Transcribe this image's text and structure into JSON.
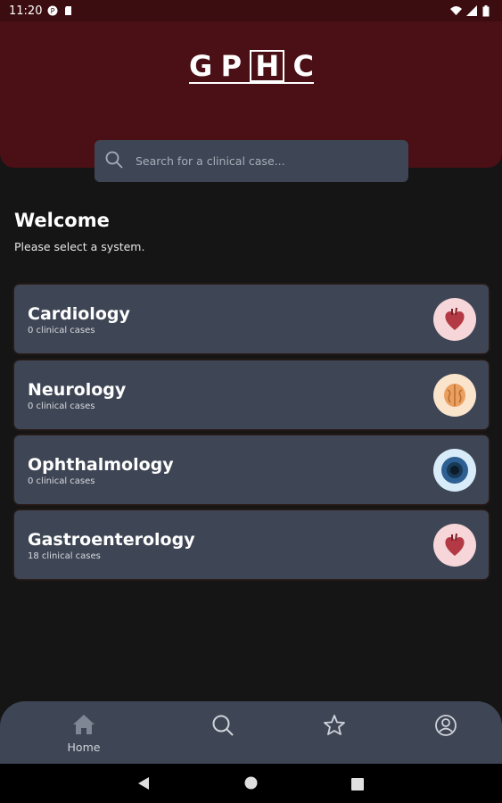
{
  "status_bar": {
    "time": "11:20"
  },
  "header": {
    "logo_letters": [
      "G",
      "P",
      "H",
      "C"
    ]
  },
  "search": {
    "placeholder": "Search for a clinical case..."
  },
  "welcome": {
    "title": "Welcome",
    "subtitle": "Please select a system."
  },
  "systems": [
    {
      "name": "Cardiology",
      "count": "0 clinical cases",
      "icon": "heart-icon",
      "badge_color": "#f6d6d8"
    },
    {
      "name": "Neurology",
      "count": "0 clinical cases",
      "icon": "brain-icon",
      "badge_color": "#fbe4cc"
    },
    {
      "name": "Ophthalmology",
      "count": "0 clinical cases",
      "icon": "eye-icon",
      "badge_color": "#d7ebf8"
    },
    {
      "name": "Gastroenterology",
      "count": "18 clinical cases",
      "icon": "heart-icon",
      "badge_color": "#f6d6d8"
    }
  ],
  "bottom_nav": {
    "items": [
      {
        "label": "Home",
        "icon": "home-icon",
        "active": true
      },
      {
        "label": "",
        "icon": "search-icon",
        "active": false
      },
      {
        "label": "",
        "icon": "star-icon",
        "active": false
      },
      {
        "label": "",
        "icon": "profile-icon",
        "active": false
      }
    ]
  },
  "colors": {
    "header": "#4a1015",
    "card": "#3e4554",
    "background": "#151515"
  }
}
